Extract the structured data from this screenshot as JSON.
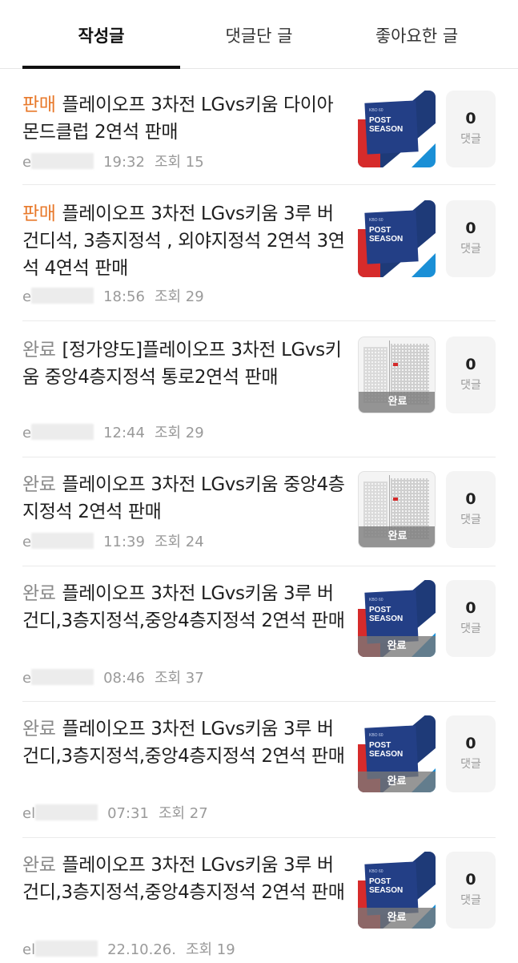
{
  "tabs": [
    {
      "label": "작성글"
    },
    {
      "label": "댓글단 글"
    },
    {
      "label": "좋아요한 글"
    }
  ],
  "posts": [
    {
      "status": "판매",
      "title": "플레이오프 3차전 LGvs키움 다이아몬드클럽 2연석 판매",
      "author": "e",
      "time": "19:32",
      "views": "조회 15",
      "comments": "0",
      "comment_label": "댓글",
      "thumb": "poster",
      "done": ""
    },
    {
      "status": "판매",
      "title": "플레이오프 3차전 LGvs키움 3루 버건디석, 3층지정석 , 외야지정석 2연석 3연석 4연석 판매",
      "author": "e",
      "time": "18:56",
      "views": "조회 29",
      "comments": "0",
      "comment_label": "댓글",
      "thumb": "poster",
      "done": ""
    },
    {
      "status": "완료",
      "title": "[정가양도]플레이오프 3차전 LGvs키움 중앙4층지정석 통로2연석 판매",
      "author": "e",
      "time": "12:44",
      "views": "조회 29",
      "comments": "0",
      "comment_label": "댓글",
      "thumb": "seat",
      "done": "완료"
    },
    {
      "status": "완료",
      "title": "플레이오프 3차전 LGvs키움 중앙4층지정석 2연석 판매",
      "author": "e",
      "time": "11:39",
      "views": "조회 24",
      "comments": "0",
      "comment_label": "댓글",
      "thumb": "seat",
      "done": "완료"
    },
    {
      "status": "완료",
      "title": "플레이오프 3차전 LGvs키움 3루 버건디,3층지정석,중앙4층지정석 2연석 판매",
      "author": "e",
      "time": "08:46",
      "views": "조회 37",
      "comments": "0",
      "comment_label": "댓글",
      "thumb": "poster",
      "done": "완료"
    },
    {
      "status": "완료",
      "title": "플레이오프 3차전 LGvs키움 3루 버건디,3층지정석,중앙4층지정석 2연석 판매",
      "author": "el",
      "time": "07:31",
      "views": "조회 27",
      "comments": "0",
      "comment_label": "댓글",
      "thumb": "poster",
      "done": "완료"
    },
    {
      "status": "완료",
      "title": "플레이오프 3차전 LGvs키움 3루 버건디,3층지정석,중앙4층지정석 2연석 판매",
      "author": "el",
      "time": "22.10.26.",
      "views": "조회 19",
      "comments": "0",
      "comment_label": "댓글",
      "thumb": "poster",
      "done": "완료"
    }
  ],
  "poster": {
    "brand": "KBO 60",
    "line1": "POST",
    "line2": "SEASON"
  },
  "colors": {
    "sale": "#e8792b",
    "done": "#8a8a8a",
    "accent": "#111111"
  }
}
